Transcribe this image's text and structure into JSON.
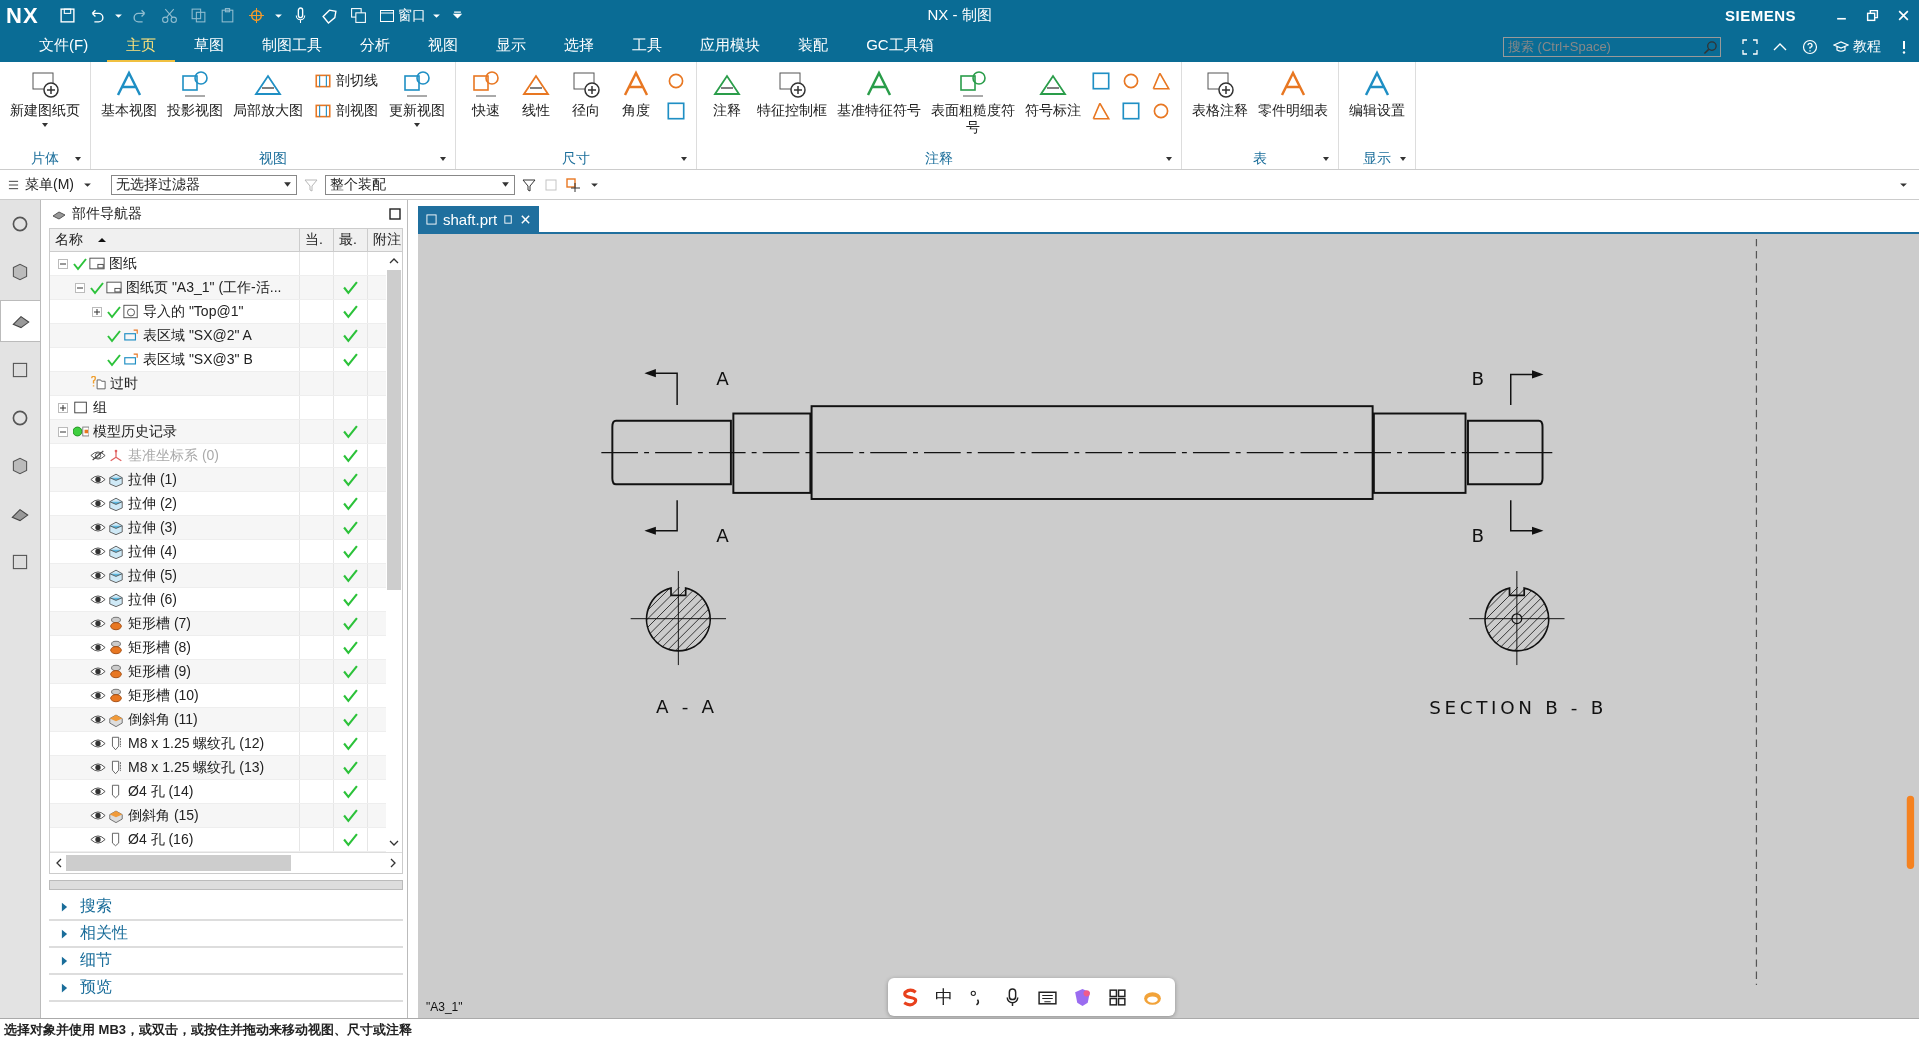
{
  "window": {
    "logo": "NX",
    "title": "NX - 制图",
    "brand": "SIEMENS",
    "window_menu": "窗口"
  },
  "menu_tabs": [
    {
      "label": "文件(F)",
      "selected": false
    },
    {
      "label": "主页",
      "selected": true
    },
    {
      "label": "草图",
      "selected": false
    },
    {
      "label": "制图工具",
      "selected": false
    },
    {
      "label": "分析",
      "selected": false
    },
    {
      "label": "视图",
      "selected": false
    },
    {
      "label": "显示",
      "selected": false
    },
    {
      "label": "选择",
      "selected": false
    },
    {
      "label": "工具",
      "selected": false
    },
    {
      "label": "应用模块",
      "selected": false
    },
    {
      "label": "装配",
      "selected": false
    },
    {
      "label": "GC工具箱",
      "selected": false
    }
  ],
  "search": {
    "placeholder": "搜索 (Ctrl+Space)"
  },
  "tutorial_button": "教程",
  "ribbon_groups": [
    {
      "label": "片体",
      "buttons": [
        {
          "kind": "large",
          "label": "新建图纸页",
          "dropdown": true
        }
      ]
    },
    {
      "label": "视图",
      "buttons": [
        {
          "kind": "large",
          "label": "基本视图",
          "dropdown": false
        },
        {
          "kind": "large",
          "label": "投影视图",
          "dropdown": false
        },
        {
          "kind": "large",
          "label": "局部放大图",
          "dropdown": false
        },
        {
          "kind": "small",
          "label": "剖切线"
        },
        {
          "kind": "small",
          "label": "剖视图"
        },
        {
          "kind": "large",
          "label": "更新视图",
          "dropdown": true
        }
      ]
    },
    {
      "label": "尺寸",
      "buttons": [
        {
          "kind": "large",
          "label": "快速",
          "dropdown": false
        },
        {
          "kind": "large",
          "label": "线性",
          "dropdown": false
        },
        {
          "kind": "large",
          "label": "径向",
          "dropdown": false
        },
        {
          "kind": "large",
          "label": "角度",
          "dropdown": false
        },
        {
          "kind": "icon"
        },
        {
          "kind": "icon"
        }
      ]
    },
    {
      "label": "注释",
      "buttons": [
        {
          "kind": "large",
          "label": "注释",
          "dropdown": false
        },
        {
          "kind": "large",
          "label": "特征控制框",
          "dropdown": false
        },
        {
          "kind": "large",
          "label": "基准特征符号",
          "dropdown": false
        },
        {
          "kind": "large",
          "label": "表面粗糙度符号",
          "dropdown": false
        },
        {
          "kind": "large",
          "label": "符号标注",
          "dropdown": false
        },
        {
          "kind": "icon"
        },
        {
          "kind": "icon"
        },
        {
          "kind": "icon"
        },
        {
          "kind": "icon"
        },
        {
          "kind": "icon"
        },
        {
          "kind": "icon"
        }
      ]
    },
    {
      "label": "表",
      "buttons": [
        {
          "kind": "large",
          "label": "表格注释",
          "dropdown": false
        },
        {
          "kind": "large",
          "label": "零件明细表",
          "dropdown": false
        }
      ]
    },
    {
      "label": "显示",
      "buttons": [
        {
          "kind": "large",
          "label": "编辑设置",
          "dropdown": false
        }
      ]
    }
  ],
  "toolbar": {
    "menu_button": "菜单(M)",
    "filter_select": "无选择过滤器",
    "scope_select": "整个装配"
  },
  "resource_bar": [
    {
      "selected": false
    },
    {
      "selected": false
    },
    {
      "selected": true
    },
    {
      "selected": false
    },
    {
      "selected": false
    },
    {
      "selected": false
    },
    {
      "selected": false
    },
    {
      "selected": false
    }
  ],
  "navigator": {
    "title": "部件导航器",
    "columns": [
      "名称",
      "当.",
      "最.",
      "附注"
    ],
    "tree": [
      {
        "kind": "sheets",
        "label": "图纸",
        "checked": true,
        "latest": false,
        "expanded": true,
        "children": [
          {
            "kind": "sheet",
            "label": "图纸页 \"A3_1\" (工作-活...",
            "checked": true,
            "latest": true,
            "expanded": true,
            "children": [
              {
                "kind": "view",
                "label": "导入的 \"Top@1\"",
                "checked": true,
                "latest": true,
                "expanded": false
              },
              {
                "kind": "section",
                "label": "表区域 \"SX@2\" A",
                "checked": true,
                "latest": true
              },
              {
                "kind": "section",
                "label": "表区域 \"SX@3\" B",
                "checked": true,
                "latest": true
              }
            ]
          },
          {
            "kind": "obsolete",
            "label": "过时",
            "checked": false,
            "latest": false
          }
        ]
      },
      {
        "kind": "group",
        "label": "组",
        "checked": false,
        "latest": false,
        "expanded": false
      },
      {
        "kind": "history",
        "label": "模型历史记录",
        "checked": false,
        "latest": true,
        "expanded": true,
        "children": [
          {
            "kind": "datum",
            "label": "基准坐标系 (0)",
            "hidden": true,
            "latest": true
          },
          {
            "kind": "extrude",
            "label": "拉伸 (1)",
            "hidden": false,
            "latest": true
          },
          {
            "kind": "extrude",
            "label": "拉伸 (2)",
            "hidden": false,
            "latest": true
          },
          {
            "kind": "extrude",
            "label": "拉伸 (3)",
            "hidden": false,
            "latest": true
          },
          {
            "kind": "extrude",
            "label": "拉伸 (4)",
            "hidden": false,
            "latest": true
          },
          {
            "kind": "extrude",
            "label": "拉伸 (5)",
            "hidden": false,
            "latest": true
          },
          {
            "kind": "extrude",
            "label": "拉伸 (6)",
            "hidden": false,
            "latest": true
          },
          {
            "kind": "slot",
            "label": "矩形槽 (7)",
            "hidden": false,
            "latest": true
          },
          {
            "kind": "slot",
            "label": "矩形槽 (8)",
            "hidden": false,
            "latest": true
          },
          {
            "kind": "slot",
            "label": "矩形槽 (9)",
            "hidden": false,
            "latest": true
          },
          {
            "kind": "slot",
            "label": "矩形槽 (10)",
            "hidden": false,
            "latest": true
          },
          {
            "kind": "chamfer",
            "label": "倒斜角 (11)",
            "hidden": false,
            "latest": true
          },
          {
            "kind": "thread",
            "label": "M8 x 1.25 螺纹孔 (12)",
            "hidden": false,
            "latest": true
          },
          {
            "kind": "thread",
            "label": "M8 x 1.25 螺纹孔 (13)",
            "hidden": false,
            "latest": true
          },
          {
            "kind": "hole",
            "label": "Ø4 孔 (14)",
            "hidden": false,
            "latest": true
          },
          {
            "kind": "chamfer",
            "label": "倒斜角 (15)",
            "hidden": false,
            "latest": true
          },
          {
            "kind": "hole",
            "label": "Ø4 孔 (16)",
            "hidden": false,
            "latest": true
          }
        ]
      }
    ],
    "sections": [
      {
        "label": "搜索",
        "expanded": false
      },
      {
        "label": "相关性",
        "expanded": false
      },
      {
        "label": "细节",
        "expanded": false
      },
      {
        "label": "预览",
        "expanded": false
      }
    ]
  },
  "document_tab": {
    "label": "shaft.prt",
    "selected": true
  },
  "drawing": {
    "cut_labels": [
      "A",
      "A",
      "B",
      "B"
    ],
    "section_titles": [
      "A - A",
      "SECTION B - B"
    ],
    "sheet_label": "\"A3_1\""
  },
  "ime_toolbar": {
    "mode": "中"
  },
  "status_bar": "选择对象并使用 MB3，或双击，或按住并拖动来移动视图、尺寸或注释"
}
